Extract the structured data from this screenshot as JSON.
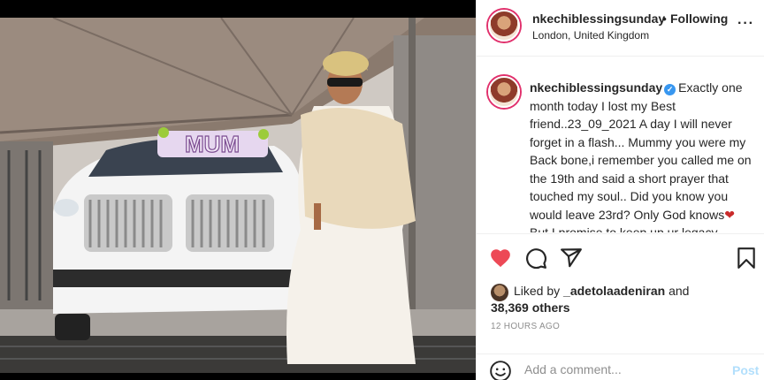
{
  "colors": {
    "accent": "#0095f6",
    "heart": "#ed4956",
    "ring": "#e1306c",
    "post_disabled": "#b2dffc"
  },
  "photo": {
    "sign_text": "MUM",
    "alt": ""
  },
  "header": {
    "username": "nkechiblessingsunday",
    "dot": "•",
    "follow_status": "Following",
    "location": "London, United Kingdom",
    "more": "···"
  },
  "caption": {
    "username": "nkechiblessingsunday",
    "verified_icon": "verified-badge-icon",
    "text": "Exactly one month today I lost my Best friend..23_09_2021 A day I will never forget in a flash... Mummy you were my Back bone,i remember you called me on the 19th and said a short prayer that touched my soul.. Did you know you would leave 23rd? Only God knows",
    "emoji": "❤",
    "text_after": "But I promise to keep up ur legacy. Mummy a lot of people had nice"
  },
  "actions": {
    "like_icon": "heart-filled-icon",
    "comment_icon": "comment-bubble-icon",
    "share_icon": "paper-plane-icon",
    "save_icon": "bookmark-icon"
  },
  "likes": {
    "prefix": "Liked by",
    "user": "_adetolaadeniran",
    "and": "and",
    "count": "38,369 others"
  },
  "timestamp": "12 HOURS AGO",
  "comment": {
    "placeholder": "Add a comment...",
    "post_label": "Post"
  }
}
